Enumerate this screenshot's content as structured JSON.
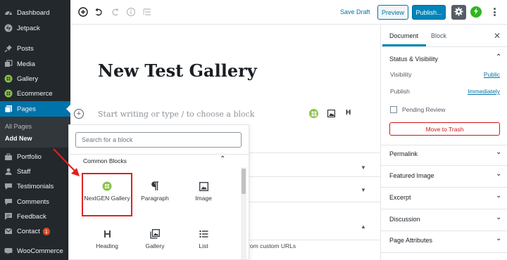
{
  "admin_menu": {
    "items": [
      {
        "label": "Dashboard",
        "icon": "dashboard-icon"
      },
      {
        "label": "Jetpack",
        "icon": "jetpack-icon"
      },
      {
        "label": "Posts",
        "icon": "pin-icon"
      },
      {
        "label": "Media",
        "icon": "media-icon"
      },
      {
        "label": "Gallery",
        "icon": "nextgen-icon"
      },
      {
        "label": "Ecommerce",
        "icon": "nextgen-icon"
      },
      {
        "label": "Pages",
        "icon": "pages-icon",
        "active": true
      },
      {
        "label": "Portfolio",
        "icon": "portfolio-icon"
      },
      {
        "label": "Staff",
        "icon": "staff-icon"
      },
      {
        "label": "Testimonials",
        "icon": "testimonials-icon"
      },
      {
        "label": "Comments",
        "icon": "comments-icon"
      },
      {
        "label": "Feedback",
        "icon": "feedback-icon"
      },
      {
        "label": "Contact",
        "icon": "contact-icon",
        "badge": "1"
      },
      {
        "label": "WooCommerce",
        "icon": "woocommerce-icon"
      }
    ],
    "submenu": [
      "All Pages",
      "Add New"
    ]
  },
  "toolbar": {
    "save_draft": "Save Draft",
    "preview": "Preview",
    "publish": "Publish..."
  },
  "editor": {
    "title": "New Test Gallery",
    "placeholder": "Start writing or type / to choose a block",
    "quick_heading": "H",
    "custom_urls_text": "t from custom URLs"
  },
  "inserter": {
    "search_placeholder": "Search for a block",
    "section_title": "Common Blocks",
    "blocks": [
      {
        "label": "NextGEN Gallery",
        "icon": "nextgen-gallery-icon"
      },
      {
        "label": "Paragraph",
        "icon": "paragraph-icon"
      },
      {
        "label": "Image",
        "icon": "image-icon"
      },
      {
        "label": "Heading",
        "icon": "heading-icon"
      },
      {
        "label": "Gallery",
        "icon": "gallery-icon"
      },
      {
        "label": "List",
        "icon": "list-icon"
      }
    ]
  },
  "settings": {
    "tabs": [
      "Document",
      "Block"
    ],
    "status_panel": {
      "title": "Status & Visibility",
      "visibility_label": "Visibility",
      "visibility_value": "Public",
      "publish_label": "Publish",
      "publish_value": "Immediately",
      "pending_review": "Pending Review",
      "trash": "Move to Trash"
    },
    "panels": [
      "Permalink",
      "Featured Image",
      "Excerpt",
      "Discussion",
      "Page Attributes"
    ]
  },
  "colors": {
    "admin_bg": "#23282d",
    "accent": "#0073aa",
    "publish": "#0085ba",
    "nextgen_green": "#8bc34a",
    "highlight_red": "#e02020"
  }
}
